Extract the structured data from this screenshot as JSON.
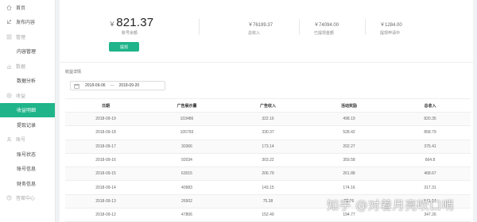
{
  "sidebar": {
    "items": [
      {
        "label": "首页",
        "type": "top",
        "icon": "home-icon"
      },
      {
        "label": "发布内容",
        "type": "top",
        "icon": "publish-icon"
      },
      {
        "label": "管理",
        "type": "section",
        "icon": "manage-icon"
      },
      {
        "label": "内容管理",
        "type": "sub"
      },
      {
        "label": "数据",
        "type": "section",
        "icon": "data-icon"
      },
      {
        "label": "数据分析",
        "type": "sub"
      },
      {
        "label": "收益",
        "type": "section",
        "icon": "income-icon"
      },
      {
        "label": "收益明细",
        "type": "sub",
        "active": true
      },
      {
        "label": "提现记录",
        "type": "sub"
      },
      {
        "label": "账号",
        "type": "section",
        "icon": "account-icon"
      },
      {
        "label": "账号状态",
        "type": "sub"
      },
      {
        "label": "账号信息",
        "type": "sub"
      },
      {
        "label": "财务信息",
        "type": "sub"
      },
      {
        "label": "答案中心",
        "type": "section",
        "icon": "help-icon"
      }
    ]
  },
  "summary": {
    "balance_currency": "￥",
    "balance_value": "821.37",
    "balance_label": "账号余额",
    "withdraw_label": "提现",
    "stats": [
      {
        "value": "￥76199.37",
        "label": "总收入"
      },
      {
        "value": "￥74094.00",
        "label": "已提现金额"
      },
      {
        "value": "￥1284.00",
        "label": "提现申请中"
      }
    ]
  },
  "detail": {
    "title": "收益详情",
    "date_start": "2018-09-06",
    "date_separator": "—",
    "date_end": "2018-09-20"
  },
  "table": {
    "headers": [
      "日期",
      "广告展示量",
      "广告收入",
      "活动奖励",
      "总收入"
    ],
    "rows": [
      [
        "2018-09-19",
        "103486",
        "322.16",
        "498.19",
        "820.35"
      ],
      [
        "2018-09-18",
        "105793",
        "330.37",
        "528.42",
        "858.79"
      ],
      [
        "2018-09-17",
        "30366",
        "173.14",
        "202.27",
        "375.41"
      ],
      [
        "2018-09-16",
        "92034",
        "303.22",
        "359.58",
        "664.8"
      ],
      [
        "2018-09-15",
        "63015",
        "206.79",
        "261.88",
        "468.67"
      ],
      [
        "2018-09-14",
        "40983",
        "143.15",
        "174.16",
        "317.31"
      ],
      [
        "2018-09-13",
        "26502",
        "75.38",
        "95.76",
        "171.14"
      ],
      [
        "2018-09-12",
        "47806",
        "152.49",
        "194.77",
        "347.26"
      ]
    ]
  },
  "watermark": "知乎 @对着月亮吹口哨",
  "colors": {
    "accent": "#1fb48a",
    "sidebar_bg": "#ffffff",
    "page_bg": "#f0f2f5"
  }
}
